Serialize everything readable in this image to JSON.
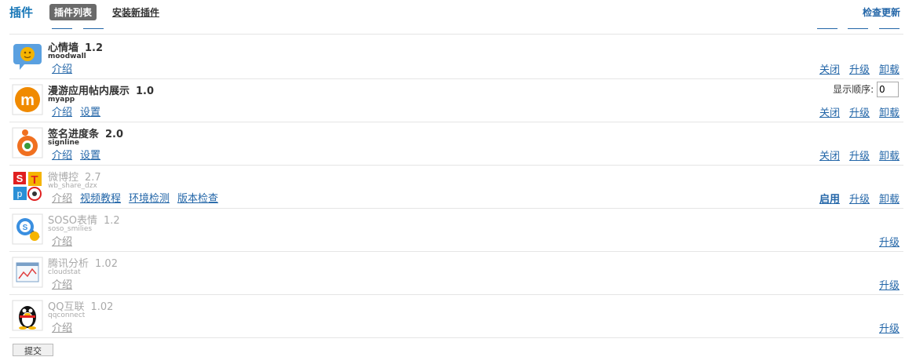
{
  "header": {
    "title": "插件",
    "tab_active": "插件列表",
    "tab_install": "安装新插件",
    "check_update": "检查更新"
  },
  "plugins": [
    {
      "name": "心情墙",
      "version": "1.2",
      "id": "moodwall",
      "links": [
        "介绍"
      ],
      "actions": [
        "关闭",
        "升级",
        "卸载"
      ],
      "enabled": true,
      "icon": "mood-icon"
    },
    {
      "name": "漫游应用帖内展示",
      "version": "1.0",
      "id": "myapp",
      "links": [
        "介绍",
        "设置"
      ],
      "actions": [
        "关闭",
        "升级",
        "卸载"
      ],
      "enabled": true,
      "icon": "manyou-icon",
      "order_label": "显示顺序:",
      "order_value": "0"
    },
    {
      "name": "签名进度条",
      "version": "2.0",
      "id": "signline",
      "links": [
        "介绍",
        "设置"
      ],
      "actions": [
        "关闭",
        "升级",
        "卸载"
      ],
      "enabled": true,
      "icon": "signline-icon"
    },
    {
      "name": "微博控",
      "version": "2.7",
      "id": "wb_share_dzx",
      "links": [
        "介绍",
        "视频教程",
        "环境检测",
        "版本检查"
      ],
      "actions": [
        "启用",
        "升级",
        "卸载"
      ],
      "enabled": false,
      "icon": "weibo-icon"
    },
    {
      "name": "SOSO表情",
      "version": "1.2",
      "id": "soso_smilies",
      "links": [
        "介绍"
      ],
      "actions": [
        "升级"
      ],
      "enabled": false,
      "icon": "soso-icon"
    },
    {
      "name": "腾讯分析",
      "version": "1.02",
      "id": "cloudstat",
      "links": [
        "介绍"
      ],
      "actions": [
        "升级"
      ],
      "enabled": false,
      "icon": "stats-icon"
    },
    {
      "name": "QQ互联",
      "version": "1.02",
      "id": "qqconnect",
      "links": [
        "介绍"
      ],
      "actions": [
        "升级"
      ],
      "enabled": false,
      "icon": "qq-penguin-icon"
    }
  ],
  "footer": {
    "button_label": "提交"
  }
}
